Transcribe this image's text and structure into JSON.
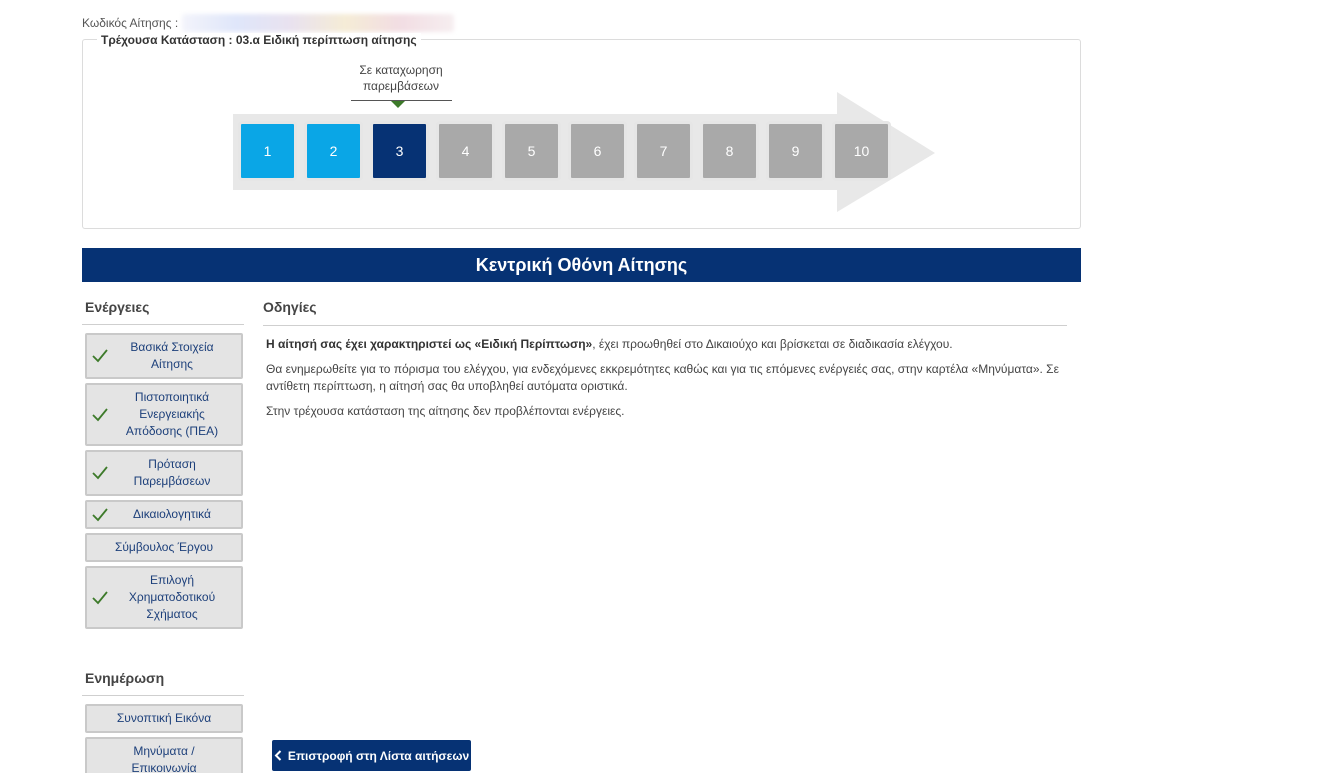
{
  "header": {
    "app_code_label": "Κωδικός Αίτησης :",
    "current_status_label": "Τρέχουσα Κατάσταση : 03.α Ειδική περίπτωση αίτησης"
  },
  "progress": {
    "tooltip_line1": "Σε καταχωρηση",
    "tooltip_line2": "παρεμβάσεων",
    "current_step": 3,
    "steps": [
      {
        "label": "1",
        "state": "done"
      },
      {
        "label": "2",
        "state": "done"
      },
      {
        "label": "3",
        "state": "current"
      },
      {
        "label": "4",
        "state": "pending"
      },
      {
        "label": "5",
        "state": "pending"
      },
      {
        "label": "6",
        "state": "pending"
      },
      {
        "label": "7",
        "state": "pending"
      },
      {
        "label": "8",
        "state": "pending"
      },
      {
        "label": "9",
        "state": "pending"
      },
      {
        "label": "10",
        "state": "pending"
      }
    ],
    "colors": {
      "done": "#0aa6e6",
      "current": "#063274",
      "pending": "#a9a9a9"
    }
  },
  "main": {
    "title": "Κεντρική Οθόνη Αίτησης"
  },
  "sidebar": {
    "actions_heading": "Ενέργειες",
    "actions": [
      {
        "line1": "Βασικά Στοιχεία",
        "line2": "Αίτησης",
        "line3": "",
        "checked": true,
        "icon": "check-icon"
      },
      {
        "line1": "Πιστοποιητικά",
        "line2": "Ενεργειακής",
        "line3": "Απόδοσης (ΠΕΑ)",
        "checked": true,
        "icon": "check-icon"
      },
      {
        "line1": "Πρόταση",
        "line2": "Παρεμβάσεων",
        "line3": "",
        "checked": true,
        "icon": "check-icon"
      },
      {
        "line1": "Δικαιολογητικά",
        "line2": "",
        "line3": "",
        "checked": true,
        "icon": "check-icon"
      },
      {
        "line1": "Σύμβουλος Έργου",
        "line2": "",
        "line3": "",
        "checked": false
      },
      {
        "line1": "Επιλογή",
        "line2": "Χρηματοδοτικού",
        "line3": "Σχήματος",
        "checked": true,
        "icon": "check-icon"
      }
    ],
    "update_heading": "Ενημέρωση",
    "updates": [
      {
        "line1": "Συνοπτική Εικόνα",
        "line2": ""
      },
      {
        "line1": "Μηνύματα /",
        "line2": "Επικοινωνία"
      }
    ]
  },
  "content": {
    "heading": "Οδηγίες",
    "p1_bold": "Η αίτησή σας έχει χαρακτηριστεί ως «Ειδική Περίπτωση»",
    "p1_rest": ", έχει προωθηθεί στο Δικαιούχο και βρίσκεται σε διαδικασία ελέγχου.",
    "p2": "Θα ενημερωθείτε για το πόρισμα του ελέγχου, για ενδεχόμενες εκκρεμότητες καθώς και για τις επόμενες ενέργειές σας, στην καρτέλα «Μηνύματα». Σε αντίθετη περίπτωση, η αίτησή σας θα υποβληθεί αυτόματα οριστικά.",
    "p3": "Στην τρέχουσα κατάσταση της αίτησης δεν προβλέπονται ενέργειες."
  },
  "footer": {
    "back_label": "Επιστροφή στη Λίστα αιτήσεων",
    "back_icon": "chevron-left-icon"
  }
}
